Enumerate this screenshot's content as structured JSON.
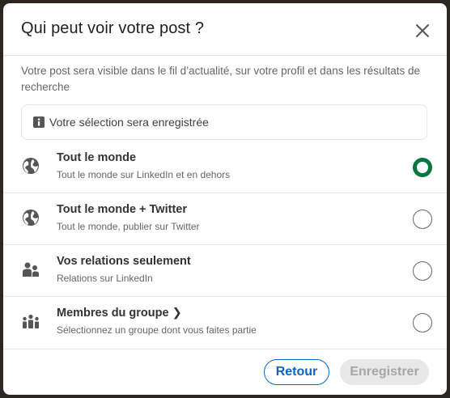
{
  "dialog": {
    "title": "Qui peut voir votre post ?",
    "close_icon": "close-icon",
    "description": "Votre post sera visible dans le fil d’actualité, sur votre profil et dans les résultats de recherche",
    "notice": {
      "icon": "info-icon",
      "text": "Votre sélection sera enregistrée"
    }
  },
  "options": [
    {
      "icon": "globe-icon",
      "title": "Tout le monde",
      "subtitle": "Tout le monde sur LinkedIn et en dehors",
      "selected": true
    },
    {
      "icon": "globe-icon",
      "title": "Tout le monde + Twitter",
      "subtitle": "Tout le monde, publier sur Twitter",
      "selected": false
    },
    {
      "icon": "people-icon",
      "title": "Vos relations seulement",
      "subtitle": "Relations sur LinkedIn",
      "selected": false
    },
    {
      "icon": "group-icon",
      "title": "Membres du groupe ❯",
      "subtitle": "Sélectionnez un groupe dont vous faites partie",
      "selected": false
    }
  ],
  "footer": {
    "back_label": "Retour",
    "save_label": "Enregistrer"
  },
  "colors": {
    "accent_blue": "#0a66c2",
    "selected_green": "#057642",
    "disabled_gray": "#e8e8e8"
  }
}
